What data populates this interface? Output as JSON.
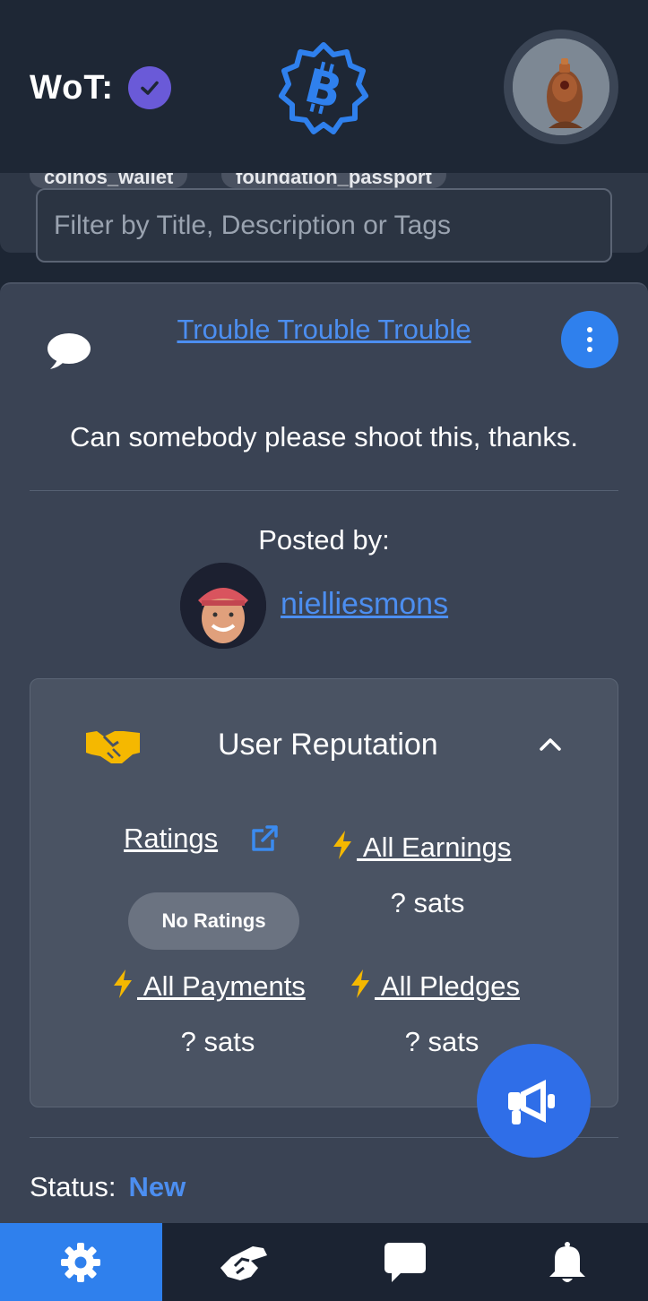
{
  "header": {
    "wot_label": "WoT:",
    "icons": {
      "verified": "check-circle-icon",
      "logo": "bitcoin-badge-icon",
      "avatar": "user-avatar"
    }
  },
  "filter": {
    "tags": [
      "coinos_wallet",
      "foundation_passport"
    ],
    "placeholder": "Filter by Title, Description or Tags"
  },
  "post": {
    "title": "Trouble Trouble Trouble",
    "description": "Can somebody please shoot this, thanks.",
    "posted_by_label": "Posted by:",
    "author": "nielliesmons",
    "status_label": "Status:",
    "status_value": "New"
  },
  "reputation": {
    "title": "User Reputation",
    "ratings_label": "Ratings",
    "no_ratings": "No Ratings",
    "earnings_label": " All Earnings",
    "earnings_value": "? sats",
    "payments_label": " All Payments",
    "payments_value": "? sats",
    "pledges_label": " All Pledges",
    "pledges_value": "? sats"
  },
  "bottom_nav": {
    "items": [
      {
        "name": "settings",
        "icon": "gear-icon",
        "active": true
      },
      {
        "name": "deals",
        "icon": "handshake-icon",
        "active": false
      },
      {
        "name": "messages",
        "icon": "chat-icon",
        "active": false
      },
      {
        "name": "notifications",
        "icon": "bell-icon",
        "active": false
      }
    ]
  },
  "colors": {
    "accent": "#2f80ed",
    "link": "#4c8ef0",
    "verified": "#6a5ad8",
    "bolt": "#f5b800",
    "background": "#1d2634",
    "card": "#3a4354"
  }
}
